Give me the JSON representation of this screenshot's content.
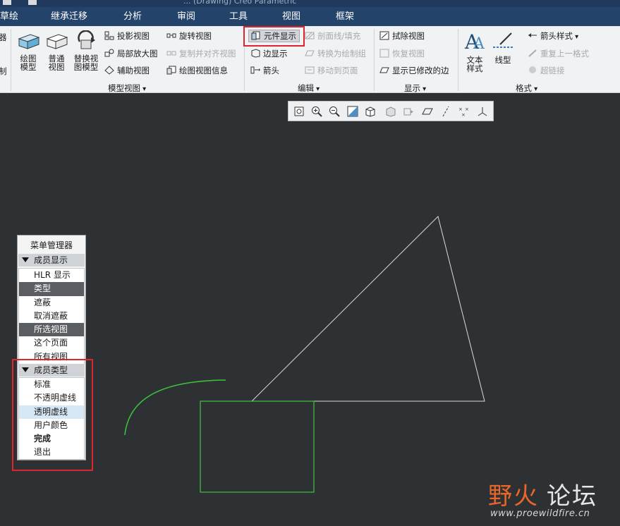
{
  "window": {
    "title": "... (Drawing) Creo Parametric"
  },
  "menu": {
    "tabs": [
      {
        "label": "草绘"
      },
      {
        "label": "继承迁移"
      },
      {
        "label": "分析"
      },
      {
        "label": "审阅"
      },
      {
        "label": "工具"
      },
      {
        "label": "视图"
      },
      {
        "label": "框架"
      }
    ]
  },
  "ribbon": {
    "left_cut": {
      "top": "器",
      "bottom": "制"
    },
    "model_view": {
      "drawing_model": "绘图\n模型",
      "normal_view": "普通\n视图",
      "replace_model": "替换视\n图模型",
      "projection_view": "投影视图",
      "detail_view": "局部放大图",
      "auxiliary_view": "辅助视图",
      "revolve_view": "旋转视图",
      "copy_align_view": "复制并对齐视图",
      "drawing_view_info": "绘图视图信息",
      "group_label": "模型视图"
    },
    "edit": {
      "component_display": "元件显示",
      "edge_display": "边显示",
      "arrow": "箭头",
      "section_fill": "剖面线/填充",
      "convert_to_drawing_group": "转换为绘制组",
      "move_to_page": "移动到页面",
      "group_label": "编辑"
    },
    "display": {
      "erase_view": "拭除视图",
      "restore_view": "恢复视图",
      "show_modified_edges": "显示已修改的边",
      "group_label": "显示"
    },
    "format": {
      "text_style": "文本\n样式",
      "line_style": "线型",
      "arrow_style": "箭头样式",
      "repeat_last_format": "重复上一格式",
      "hyperlink": "超链接",
      "group_label": "格式"
    }
  },
  "menu_manager": {
    "title": "菜单管理器",
    "section1": {
      "title": "成员显示",
      "items": [
        {
          "label": "HLR 显示",
          "state": "normal"
        },
        {
          "label": "类型",
          "state": "selected"
        },
        {
          "label": "遮蔽",
          "state": "normal"
        },
        {
          "label": "取消遮蔽",
          "state": "normal"
        },
        {
          "label": "所选视图",
          "state": "selected"
        },
        {
          "label": "这个页面",
          "state": "normal"
        },
        {
          "label": "所有视图",
          "state": "normal"
        }
      ]
    },
    "section2": {
      "title": "成员类型",
      "items": [
        {
          "label": "标准",
          "state": "normal"
        },
        {
          "label": "不透明虚线",
          "state": "normal"
        },
        {
          "label": "透明虚线",
          "state": "hover"
        },
        {
          "label": "用户颜色",
          "state": "normal"
        },
        {
          "label": "完成",
          "state": "bold"
        },
        {
          "label": "退出",
          "state": "normal"
        }
      ]
    }
  },
  "watermark": {
    "cn_part1": "野火",
    "cn_part2": "论坛",
    "url": "www.proewildfire.cn"
  },
  "colors": {
    "canvas": "#2e3134",
    "menubar": "#23436a",
    "ribbon": "#f1f2f4",
    "highlight": "#e0242b",
    "geometry_green": "#3fc43a",
    "geometry_white": "#d9d9d9",
    "watermark_orange": "#e8662a"
  },
  "icons": {
    "graphics_toolbar": [
      "refit-icon",
      "zoom-in-icon",
      "zoom-out-icon",
      "repaint-icon",
      "display-style-icon",
      "saved-orientations-icon",
      "view-manager-icon",
      "plane-display-icon",
      "axis-display-icon",
      "point-display-icon",
      "csys-display-icon"
    ]
  }
}
